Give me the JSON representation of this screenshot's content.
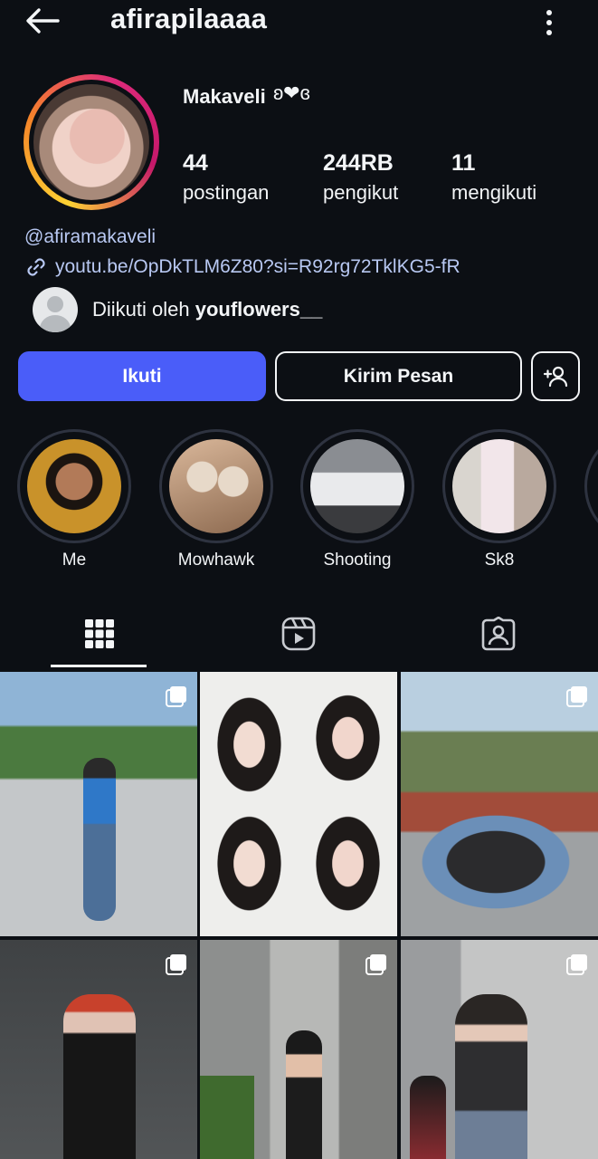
{
  "header": {
    "username": "afirapilaaaa",
    "back_icon": "arrow-left-icon",
    "more_icon": "vertical-dots-icon"
  },
  "profile": {
    "display_name": "Makaveli",
    "name_decoration": "ʚ❤ɞ",
    "stats": [
      {
        "value": "44",
        "label": "postingan"
      },
      {
        "value": "244RB",
        "label": "pengikut"
      },
      {
        "value": "11",
        "label": "mengikuti"
      }
    ],
    "handle": "@afiramakaveli",
    "link": "youtu.be/OpDkTLM6Z80?si=R92rg72TklKG5-fR",
    "followed_by_prefix": "Diikuti oleh ",
    "followed_by_user": "youflowers__"
  },
  "actions": {
    "follow_label": "Ikuti",
    "message_label": "Kirim Pesan",
    "add_friend_icon": "add-person-icon"
  },
  "highlights": [
    {
      "label": "Me"
    },
    {
      "label": "Mowhawk"
    },
    {
      "label": "Shooting"
    },
    {
      "label": "Sk8"
    }
  ],
  "tabs": {
    "grid_icon": "grid-icon",
    "reels_icon": "reels-icon",
    "tagged_icon": "tagged-person-icon"
  },
  "colors": {
    "background": "#0c0f14",
    "follow_button": "#4a5df9",
    "link": "#b8c8f2"
  }
}
